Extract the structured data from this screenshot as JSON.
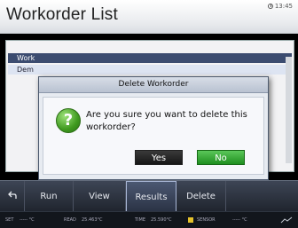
{
  "header": {
    "title": "Workorder List",
    "clock": "13:45"
  },
  "list": {
    "header_label": "Work",
    "item_label": "Dem"
  },
  "dialog": {
    "title": "Delete Workorder",
    "icon": "question-icon",
    "message": "Are you sure you want to delete this workorder?",
    "yes_label": "Yes",
    "no_label": "No"
  },
  "toolbar": {
    "back_icon": "back-arrow-icon",
    "run_label": "Run",
    "view_label": "View",
    "results_label": "Results",
    "delete_label": "Delete"
  },
  "status": {
    "set_label": "SET",
    "set_value": "----- °C",
    "read_label": "READ",
    "read_value": "25.463°C",
    "time_label": "TIME",
    "time_value": "25.590°C",
    "sensor_label": "SENSOR",
    "sensor_value": "----- °C"
  },
  "colors": {
    "accent_green": "#2f9a2c",
    "header_bg": "#eef0f3",
    "dialog_bg": "#e7ebf1",
    "toolbar_bg": "#2b3140"
  }
}
